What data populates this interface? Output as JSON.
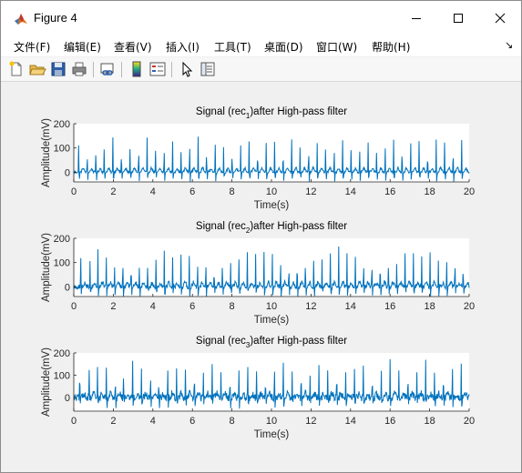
{
  "window": {
    "title": "Figure 4",
    "controls": {
      "minimize": "minimize-icon",
      "maximize": "maximize-icon",
      "close": "close-icon"
    }
  },
  "menubar": {
    "items": [
      "文件(F)",
      "编辑(E)",
      "查看(V)",
      "插入(I)",
      "工具(T)",
      "桌面(D)",
      "窗口(W)",
      "帮助(H)"
    ],
    "dock_arrow": "↘"
  },
  "toolbar": {
    "buttons": [
      "new-figure-icon",
      "open-file-icon",
      "save-icon",
      "print-icon",
      "link-plot-icon",
      "insert-colorbar-icon",
      "insert-legend-icon",
      "edit-plot-arrow-icon",
      "property-inspector-icon"
    ]
  },
  "colors": {
    "line": "#0072BD",
    "axes_bg": "#ffffff",
    "figure_bg": "#f0f0f0"
  },
  "chart_data": [
    {
      "type": "line",
      "title": "Signal (rec1)after High-pass filter",
      "title_parts": [
        "Signal (rec",
        "1",
        ")after High-pass filter"
      ],
      "xlabel": "Time(s)",
      "ylabel": "Amplitude(mV)",
      "xlim": [
        0,
        20
      ],
      "ylim": [
        -40,
        200
      ],
      "xticks": [
        0,
        2,
        4,
        6,
        8,
        10,
        12,
        14,
        16,
        18,
        20
      ],
      "yticks": [
        0,
        100,
        200
      ],
      "series": [
        {
          "x": [
            0.25,
            0.68,
            1.12,
            1.54,
            1.98,
            2.41,
            2.85,
            3.28,
            3.71,
            4.14,
            4.57,
            5.0,
            5.43,
            5.86,
            6.29,
            6.72,
            7.15,
            7.58,
            8.01,
            8.44,
            8.87,
            9.3,
            9.73,
            10.16,
            10.59,
            11.02,
            11.45,
            11.88,
            12.31,
            12.74,
            13.17,
            13.6,
            14.03,
            14.46,
            14.89,
            15.32,
            15.75,
            16.18,
            16.61,
            17.04,
            17.47,
            17.9,
            18.33,
            18.76,
            19.19,
            19.62
          ],
          "y": [
            138,
            110,
            130,
            128,
            148,
            112,
            127,
            137,
            142,
            120,
            132,
            126,
            140,
            147,
            153,
            123,
            147,
            110,
            121,
            133,
            137,
            132,
            138,
            147,
            125,
            145,
            127,
            145,
            126,
            139,
            133,
            132,
            140,
            131,
            122,
            143,
            128,
            135,
            133,
            146,
            138,
            128,
            147,
            140,
            146,
            136
          ],
          "baseline_mV": 0,
          "noise_mV": 5
        }
      ]
    },
    {
      "type": "line",
      "title": "Signal (rec2)after High-pass filter",
      "title_parts": [
        "Signal (rec",
        "2",
        ")after High-pass filter"
      ],
      "xlabel": "Time(s)",
      "ylabel": "Amplitude(mV)",
      "xlim": [
        0,
        20
      ],
      "ylim": [
        -40,
        200
      ],
      "xticks": [
        0,
        2,
        4,
        6,
        8,
        10,
        12,
        14,
        16,
        18,
        20
      ],
      "yticks": [
        0,
        100,
        200
      ],
      "series": [
        {
          "x": [
            0.35,
            0.82,
            1.22,
            1.64,
            2.06,
            2.48,
            2.9,
            3.32,
            3.74,
            4.16,
            4.58,
            5.0,
            5.42,
            5.84,
            6.26,
            6.68,
            7.1,
            7.52,
            7.94,
            8.36,
            8.78,
            9.2,
            9.62,
            10.04,
            10.46,
            10.88,
            11.3,
            11.72,
            12.14,
            12.56,
            12.98,
            13.4,
            13.82,
            14.24,
            14.66,
            15.08,
            15.5,
            15.92,
            16.34,
            16.76,
            17.18,
            17.6,
            18.02,
            18.44,
            18.86,
            19.28,
            19.7
          ],
          "y": [
            152,
            118,
            165,
            142,
            125,
            160,
            140,
            155,
            120,
            138,
            162,
            128,
            150,
            145,
            132,
            158,
            124,
            148,
            136,
            140,
            155,
            130,
            146,
            158,
            142,
            128,
            156,
            138,
            150,
            125,
            148,
            160,
            138,
            150,
            128,
            152,
            146,
            142,
            135,
            155,
            140,
            132,
            158,
            128,
            150,
            140,
            122
          ],
          "baseline_mV": 0,
          "noise_mV": 9
        }
      ]
    },
    {
      "type": "line",
      "title": "Signal (rec3)after High-pass filter",
      "title_parts": [
        "Signal (rec",
        "3",
        ")after High-pass filter"
      ],
      "xlabel": "Time(s)",
      "ylabel": "Amplitude(mV)",
      "xlim": [
        0,
        20
      ],
      "ylim": [
        -60,
        200
      ],
      "xticks": [
        0,
        2,
        4,
        6,
        8,
        10,
        12,
        14,
        16,
        18,
        20
      ],
      "yticks": [
        0,
        100,
        200
      ],
      "series": [
        {
          "x": [
            0.3,
            0.78,
            1.2,
            1.65,
            2.1,
            2.52,
            2.98,
            3.42,
            3.88,
            4.3,
            4.75,
            5.2,
            5.65,
            6.1,
            6.55,
            7.0,
            7.45,
            7.9,
            8.35,
            8.8,
            9.25,
            9.7,
            10.15,
            10.6,
            11.05,
            11.5,
            11.95,
            12.4,
            12.85,
            13.3,
            13.75,
            14.2,
            14.65,
            15.1,
            15.55,
            16.0,
            16.45,
            16.9,
            17.35,
            17.8,
            18.25,
            18.7,
            19.15,
            19.6
          ],
          "y": [
            170,
            138,
            148,
            165,
            132,
            150,
            170,
            142,
            155,
            128,
            162,
            145,
            152,
            160,
            138,
            165,
            150,
            140,
            170,
            148,
            155,
            135,
            160,
            150,
            142,
            165,
            150,
            140,
            175,
            148,
            155,
            138,
            165,
            150,
            145,
            160,
            140,
            155,
            150,
            160,
            140,
            162,
            150,
            145
          ],
          "baseline_mV": 0,
          "noise_mV": 16
        }
      ]
    }
  ]
}
